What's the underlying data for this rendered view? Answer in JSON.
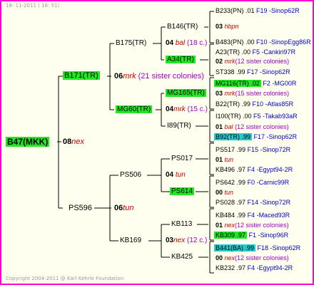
{
  "header": "18- 11-2011 ( 18: 51)",
  "footer": "Copyright 2004-2011 @ Karl Kehrle Foundation",
  "colors": {
    "border": "#ff00cc",
    "background": "#fffff0",
    "green_highlight": "#22e822",
    "cyan_highlight": "#22cccc",
    "mark": "#cc0000",
    "note": "#a000c0",
    "reference": "#0000cc"
  },
  "root": {
    "name": "B47(MKK)",
    "mating_num": "08",
    "mark": "nex"
  },
  "dam": {
    "name": "B171(TR)",
    "mating_num": "06",
    "mark": "mrk",
    "note": "(21 sister colonies)"
  },
  "sire": {
    "name": "PS596",
    "mating_num": "06",
    "mark": "tun"
  },
  "g2": [
    {
      "name": "B175(TR)",
      "mating_num": "04",
      "mark": "bal",
      "note": "(18 c.)"
    },
    {
      "name": "MG60(TR)",
      "mating_num": "04",
      "mark": "mrk",
      "note": "(15 c.)"
    },
    {
      "name": "PS506",
      "mating_num": "04",
      "mark": "tun"
    },
    {
      "name": "KB169",
      "mating_num": "03",
      "mark": "nex",
      "note": "(12 c.)"
    }
  ],
  "g3": [
    "B146(TR)",
    "A34(TR)",
    "MG165(TR)",
    "I89(TR)",
    "PS017",
    "PS614",
    "KB113",
    "KB425"
  ],
  "g4": [
    {
      "name": "B233(PN) .01",
      "ref": "F19 -Sinop62R"
    },
    {
      "num": "03",
      "mark": "hbpn"
    },
    {
      "name": "B483(PN) .00",
      "ref": "F10 -SinopEgg86R"
    },
    {
      "name": "A23(TR) .00",
      "ref": "F5 -Cankiri97R"
    },
    {
      "num": "02",
      "mark": "mrk",
      "note": "(12 sister colonies)"
    },
    {
      "name": "ST338 .99",
      "ref": "F17 -Sinop62R"
    },
    {
      "name": "MG116(TR) .02",
      "ref": "F2 -MG00R"
    },
    {
      "num": "03",
      "mark": "mrk",
      "note": "(15 sister colonies)"
    },
    {
      "name": "B22(TR) .99",
      "ref": "F10 -Atlas85R"
    },
    {
      "name": "I100(TR) .00",
      "ref": "F5 -Takab93aR"
    },
    {
      "num": "01",
      "mark": "bal",
      "note": "(12 sister colonies)"
    },
    {
      "name": "B92(TR) .99",
      "ref": "F17 -Sinop62R"
    },
    {
      "name": "PS517 .99",
      "ref": "F15 -Sinop72R"
    },
    {
      "num": "01",
      "mark": "tun"
    },
    {
      "name": "KB496 .97",
      "ref": "F4 -Egypt94-2R"
    },
    {
      "name": "PS642 .99",
      "ref": "F0 -Carnic99R"
    },
    {
      "num": "00",
      "mark": "tun"
    },
    {
      "name": "PS028 .97",
      "ref": "F14 -Sinop72R"
    },
    {
      "name": "KB484 .99",
      "ref": "F4 -Maced93R"
    },
    {
      "num": "01",
      "mark": "nex",
      "note": "(12 sister colonies)"
    },
    {
      "name": "KB309 .97",
      "ref": "F1 -Sinop96R"
    },
    {
      "name": "B441(BA) .99",
      "ref": "F18 -Sinop62R"
    },
    {
      "num": "00",
      "mark": "nex",
      "note": "(12 sister colonies)"
    },
    {
      "name": "KB232 .97",
      "ref": "F4 -Egypt94-2R"
    }
  ]
}
